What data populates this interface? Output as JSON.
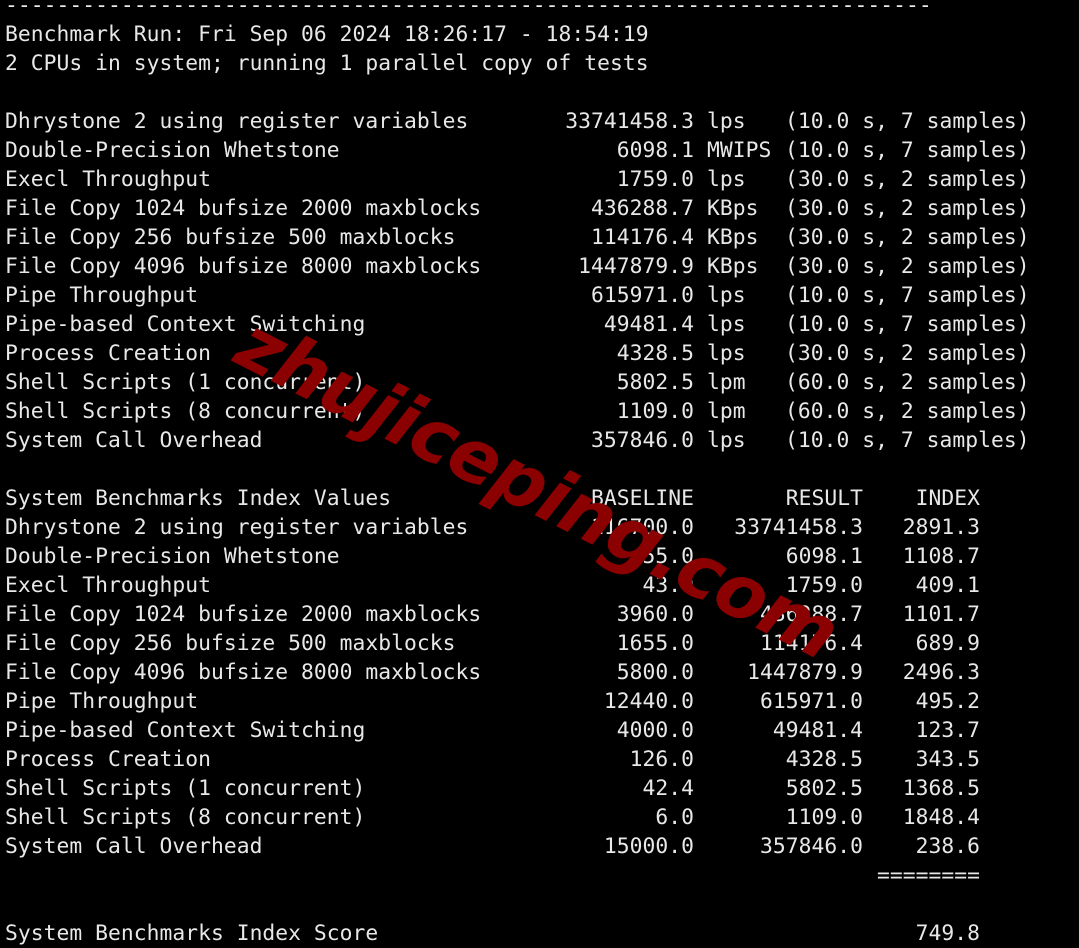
{
  "terminal": {
    "separator": "------------------------------------------------------------------------",
    "run_info": "Benchmark Run: Fri Sep 06 2024 18:26:17 - 18:54:19",
    "cpu_info": "2 CPUs in system; running 1 parallel copy of tests",
    "results": [
      {
        "name": "Dhrystone 2 using register variables",
        "value": "33741458.3",
        "unit": "lps",
        "detail": "(10.0 s, 7 samples)"
      },
      {
        "name": "Double-Precision Whetstone",
        "value": "6098.1",
        "unit": "MWIPS",
        "detail": "(10.0 s, 7 samples)"
      },
      {
        "name": "Execl Throughput",
        "value": "1759.0",
        "unit": "lps",
        "detail": "(30.0 s, 2 samples)"
      },
      {
        "name": "File Copy 1024 bufsize 2000 maxblocks",
        "value": "436288.7",
        "unit": "KBps",
        "detail": "(30.0 s, 2 samples)"
      },
      {
        "name": "File Copy 256 bufsize 500 maxblocks",
        "value": "114176.4",
        "unit": "KBps",
        "detail": "(30.0 s, 2 samples)"
      },
      {
        "name": "File Copy 4096 bufsize 8000 maxblocks",
        "value": "1447879.9",
        "unit": "KBps",
        "detail": "(30.0 s, 2 samples)"
      },
      {
        "name": "Pipe Throughput",
        "value": "615971.0",
        "unit": "lps",
        "detail": "(10.0 s, 7 samples)"
      },
      {
        "name": "Pipe-based Context Switching",
        "value": "49481.4",
        "unit": "lps",
        "detail": "(10.0 s, 7 samples)"
      },
      {
        "name": "Process Creation",
        "value": "4328.5",
        "unit": "lps",
        "detail": "(30.0 s, 2 samples)"
      },
      {
        "name": "Shell Scripts (1 concurrent)",
        "value": "5802.5",
        "unit": "lpm",
        "detail": "(60.0 s, 2 samples)"
      },
      {
        "name": "Shell Scripts (8 concurrent)",
        "value": "1109.0",
        "unit": "lpm",
        "detail": "(60.0 s, 2 samples)"
      },
      {
        "name": "System Call Overhead",
        "value": "357846.0",
        "unit": "lps",
        "detail": "(10.0 s, 7 samples)"
      }
    ],
    "index_header": {
      "title": "System Benchmarks Index Values",
      "baseline": "BASELINE",
      "result": "RESULT",
      "index": "INDEX"
    },
    "index_rows": [
      {
        "name": "Dhrystone 2 using register variables",
        "baseline": "116700.0",
        "result": "33741458.3",
        "index": "2891.3"
      },
      {
        "name": "Double-Precision Whetstone",
        "baseline": "55.0",
        "result": "6098.1",
        "index": "1108.7"
      },
      {
        "name": "Execl Throughput",
        "baseline": "43.0",
        "result": "1759.0",
        "index": "409.1"
      },
      {
        "name": "File Copy 1024 bufsize 2000 maxblocks",
        "baseline": "3960.0",
        "result": "436288.7",
        "index": "1101.7"
      },
      {
        "name": "File Copy 256 bufsize 500 maxblocks",
        "baseline": "1655.0",
        "result": "114176.4",
        "index": "689.9"
      },
      {
        "name": "File Copy 4096 bufsize 8000 maxblocks",
        "baseline": "5800.0",
        "result": "1447879.9",
        "index": "2496.3"
      },
      {
        "name": "Pipe Throughput",
        "baseline": "12440.0",
        "result": "615971.0",
        "index": "495.2"
      },
      {
        "name": "Pipe-based Context Switching",
        "baseline": "4000.0",
        "result": "49481.4",
        "index": "123.7"
      },
      {
        "name": "Process Creation",
        "baseline": "126.0",
        "result": "4328.5",
        "index": "343.5"
      },
      {
        "name": "Shell Scripts (1 concurrent)",
        "baseline": "42.4",
        "result": "5802.5",
        "index": "1368.5"
      },
      {
        "name": "Shell Scripts (8 concurrent)",
        "baseline": "6.0",
        "result": "1109.0",
        "index": "1848.4"
      },
      {
        "name": "System Call Overhead",
        "baseline": "15000.0",
        "result": "357846.0",
        "index": "238.6"
      }
    ],
    "total_rule": "========",
    "score_label": "System Benchmarks Index Score",
    "score_value": "749.8"
  },
  "watermark": {
    "text": "zhujiceping.com",
    "color": "#8b0000"
  }
}
